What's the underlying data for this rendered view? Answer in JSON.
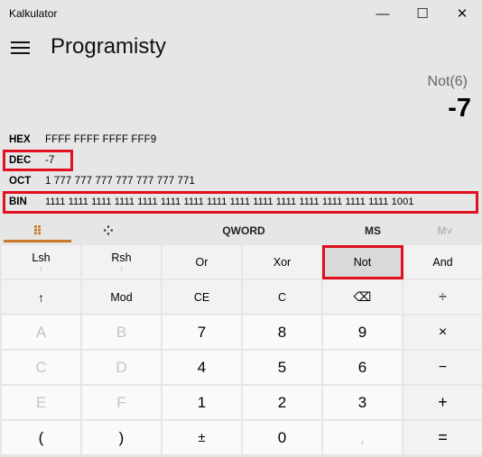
{
  "window": {
    "title": "Kalkulator",
    "controls": {
      "minimize": "—",
      "maximize": "☐",
      "close": "✕"
    }
  },
  "header": {
    "mode_title": "Programisty"
  },
  "display": {
    "expression": "Not(6)",
    "value": "-7"
  },
  "radix": [
    {
      "label": "HEX",
      "value": "FFFF FFFF FFFF FFF9"
    },
    {
      "label": "DEC",
      "value": "-7"
    },
    {
      "label": "OCT",
      "value": "1 777 777 777 777 777 777 771"
    },
    {
      "label": "BIN",
      "value": "1111 1111 1111 1111 1111 1111 1111 1111 1111 1111 1111 1111 1111 1111 1111 1001"
    }
  ],
  "toolbar": {
    "keypad_icon": "⠿",
    "bitflip_icon": "⁘",
    "word_size": "QWORD",
    "ms": "MS",
    "mr": "M˅"
  },
  "keys": {
    "row1": [
      "Lsh",
      "Rsh",
      "Or",
      "Xor",
      "Not",
      "And"
    ],
    "row1_sub": [
      "↑",
      "↑"
    ],
    "row2": [
      "↑",
      "Mod",
      "CE",
      "C",
      "⌫",
      "÷"
    ],
    "row3": [
      "A",
      "B",
      "7",
      "8",
      "9",
      "×"
    ],
    "row4": [
      "C",
      "D",
      "4",
      "5",
      "6",
      "−"
    ],
    "row5": [
      "E",
      "F",
      "1",
      "2",
      "3",
      "+"
    ],
    "row6": [
      "(",
      ")",
      "±",
      "0",
      ",",
      "="
    ]
  },
  "colors": {
    "highlight": "#e0101e",
    "accent_underline": "#c87a2b",
    "background": "#e6e6e6"
  }
}
